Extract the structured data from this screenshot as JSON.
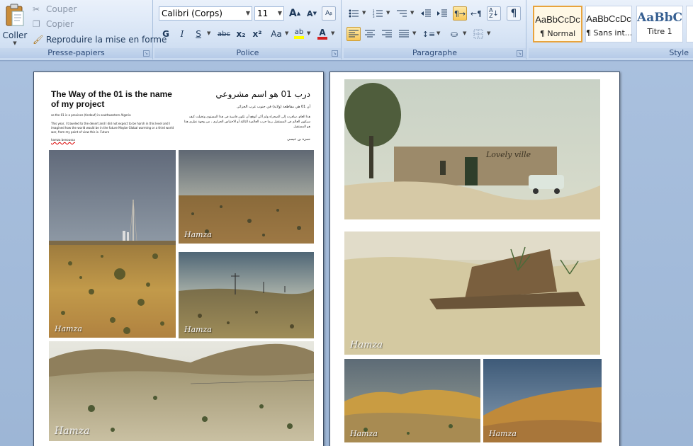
{
  "ribbon": {
    "clipboard": {
      "paste_label": "Coller",
      "cut_label": "Couper",
      "copy_label": "Copier",
      "format_painter_label": "Reproduire la mise en forme",
      "group_title": "Presse-papiers"
    },
    "font": {
      "font_name": "Calibri (Corps)",
      "font_size": "11",
      "group_title": "Police",
      "grow_label": "A",
      "shrink_label": "A",
      "bold_label": "G",
      "italic_label": "I",
      "underline_label": "S",
      "strike_label": "abc",
      "subscript_label": "x₂",
      "superscript_label": "x²",
      "case_label": "Aa",
      "font_color": "#d42020",
      "highlight_color": "#ffff00"
    },
    "paragraph": {
      "group_title": "Paragraphe"
    },
    "styles": {
      "group_title": "Style",
      "items": [
        {
          "sample": "AaBbCcDc",
          "name": "¶ Normal"
        },
        {
          "sample": "AaBbCcDc",
          "name": "¶ Sans int..."
        },
        {
          "sample": "AaBbC",
          "name": "Titre 1"
        }
      ]
    }
  },
  "page_left": {
    "title_en": "The Way of the 01 is the name of my project",
    "title_ar": "درب 01 هو اسم مشروعي",
    "subtitle_en": "so the 01 is a province (tindouf) in southwestern Algeria",
    "body_en": "This year, I traveled to the desert and I did not expect to be harsh in this level and I imagined how the world would be in the future Maybe Global warming or a third world war, from my point of view this is. Future",
    "signature_en": "hamza benoussa",
    "subtitle_ar": "أن 01 هي مقاطعة (ولاية) في جنوب غرب الجزائر.",
    "body_ar": "هذا العام، سافرت إلى الصحراء ولم أكن أتوقع أن تكون قاسية في هذا المستوى وتخيلت كيف سيكون العالم في المستقبل ربما حرب العالمية الثالثة أو الاحتباس الحراري ، من وجهة نظري هذا هو المستقبل",
    "signature_ar": "حمزة بن عيسى",
    "photo_signature": "Hamza"
  },
  "page_right": {
    "photo_signature": "Hamza",
    "wall_graffiti": "Lovely ville"
  }
}
